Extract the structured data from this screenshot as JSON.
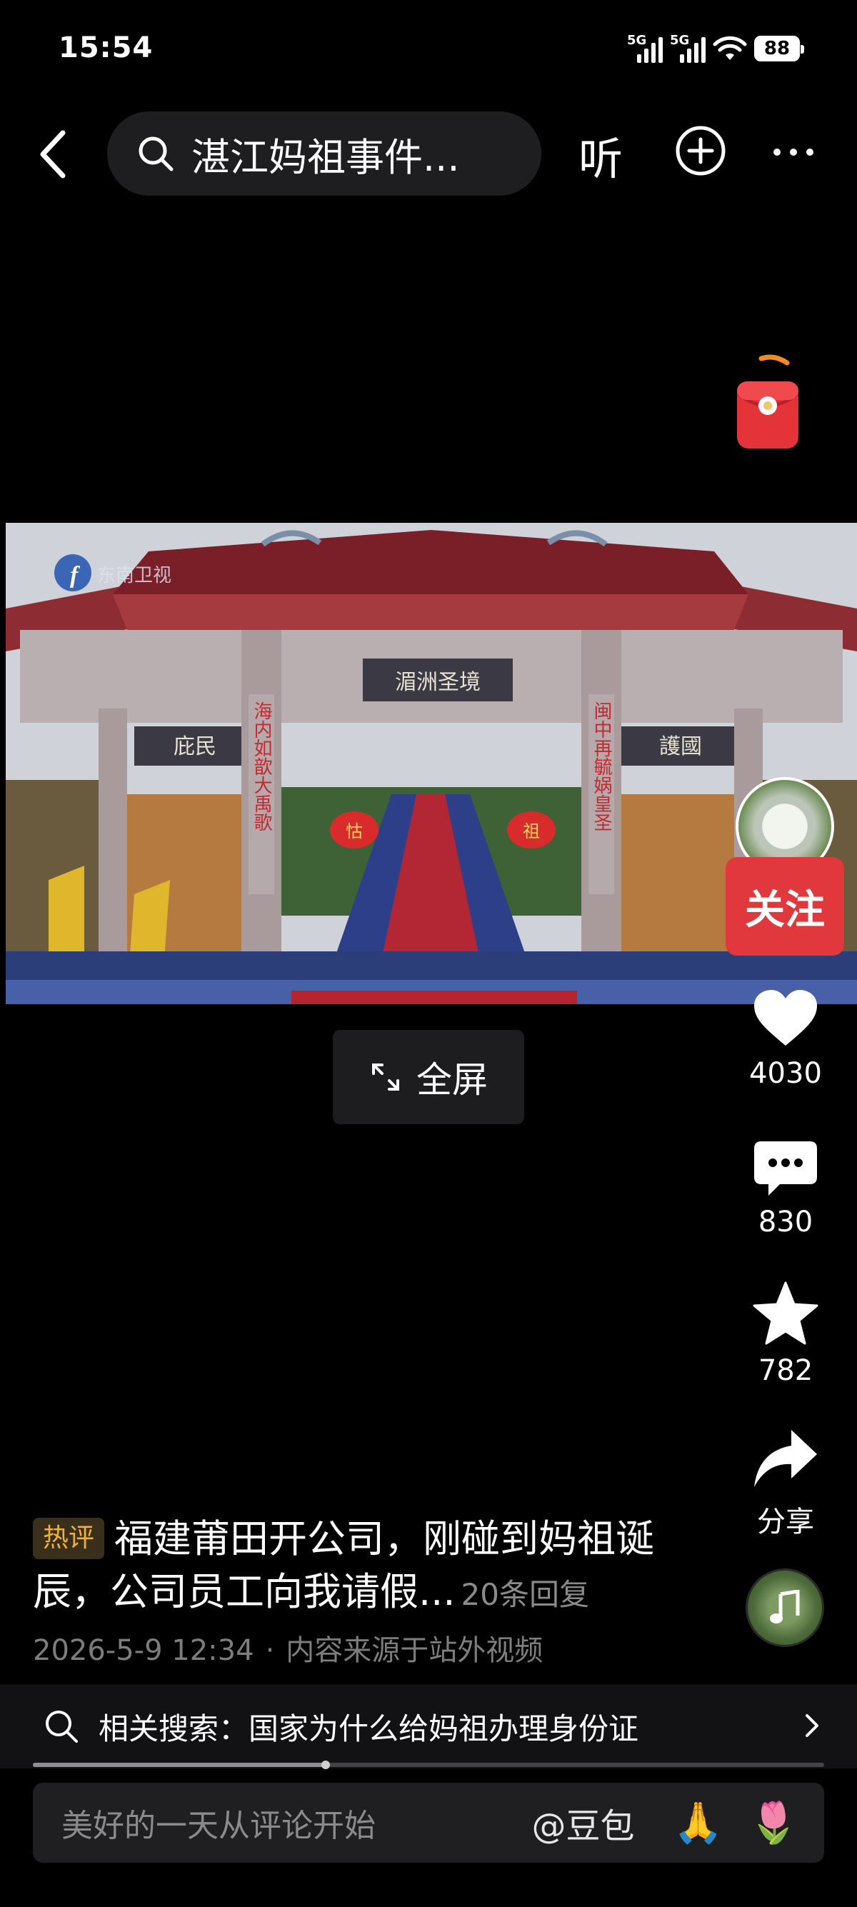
{
  "status_bar": {
    "time": "15:54",
    "signal_1": "5G",
    "signal_2": "5G",
    "battery": "88"
  },
  "top_nav": {
    "search_text": "湛江妈祖事件...",
    "listen_label": "听"
  },
  "video": {
    "watermark": "东南卫视",
    "couplet_left": "海内如歆大禹歌",
    "couplet_right": "闽中再毓娲皇圣",
    "center_plaque": "湄洲圣境",
    "left_plaque": "庇民",
    "right_plaque": "護國",
    "lantern_left": "怙",
    "lantern_right": "祖"
  },
  "fullscreen": {
    "label": "全屏"
  },
  "right_rail": {
    "follow_label": "关注",
    "like_count": "4030",
    "comment_count": "830",
    "favorite_count": "782",
    "share_label": "分享"
  },
  "caption": {
    "hot_tag": "热评",
    "text": "福建莆田开公司，刚碰到妈祖诞辰，公司员工向我请假...",
    "reply_count": "20条回复",
    "date": "2026-5-9 12:34",
    "source": "内容来源于站外视频"
  },
  "related_search": {
    "text": "相关搜索：国家为什么给妈祖办理身份证"
  },
  "progress": {
    "value": 0.37
  },
  "comment_bar": {
    "placeholder": "美好的一天从评论开始",
    "mention": "@豆包",
    "emoji_1": "🙏",
    "emoji_2": "🌷"
  },
  "icons": {
    "back": "back-arrow-icon",
    "search": "search-icon",
    "add": "add-circle-icon",
    "more": "more-dots-icon",
    "heart": "heart-icon",
    "comment": "comment-icon",
    "star": "star-icon",
    "share": "share-icon",
    "music": "music-note-icon"
  },
  "colors": {
    "follow": "#e0383c",
    "hot_tag": "#f0b13a"
  }
}
